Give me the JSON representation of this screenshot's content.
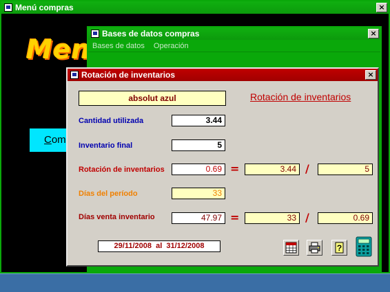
{
  "main_window": {
    "title": "Menú compras",
    "big_title": "Menú c",
    "button_label_u": "C",
    "button_label_rest": "omp"
  },
  "db_window": {
    "title": "Bases de datos compras",
    "menu": [
      "Bases de datos",
      "Operación"
    ]
  },
  "rot_window": {
    "title": "Rotación de inventarios",
    "product": "absolut azul",
    "heading": "Rotación de inventarios",
    "labels": {
      "cantidad": "Cantidad utilizada",
      "inv_final": "Inventario final",
      "rotacion": "Rotación de inventarios",
      "dias_periodo": "Días del período",
      "dias_venta": "Días venta inventario"
    },
    "values": {
      "cantidad": "3.44",
      "inv_final": "5",
      "rotacion": "0.69",
      "rot_num": "3.44",
      "rot_den": "5",
      "dias_periodo": "33",
      "dias_venta": "47.97",
      "dv_num": "33",
      "dv_den": "0.69"
    },
    "ops": {
      "eq": "=",
      "div": "/"
    },
    "date_range": "29/11/2008  al  31/12/2008"
  },
  "icons": [
    "app-icon",
    "close-icon",
    "calendar-icon",
    "printer-icon",
    "help-icon",
    "calculator-icon"
  ],
  "colors": {
    "titlebar_green": "#10b010",
    "titlebar_red": "#c00000",
    "label_blue": "#0000b0",
    "label_red": "#c00000",
    "label_orange": "#f08000"
  }
}
